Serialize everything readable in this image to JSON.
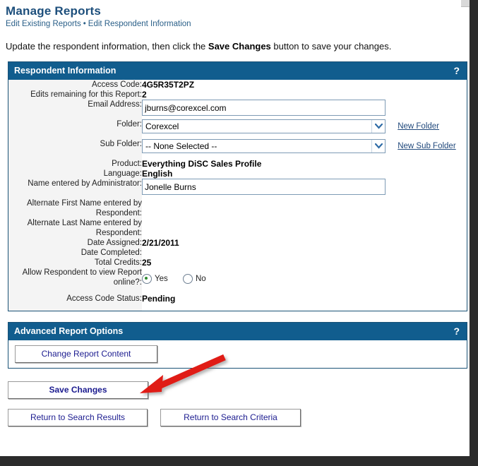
{
  "header": {
    "title": "Manage Reports",
    "breadcrumb": {
      "first": "Edit Existing Reports",
      "separator": "•",
      "second": "Edit Respondent Information"
    }
  },
  "intro": {
    "before": "Update the respondent information, then click the ",
    "emphasis": "Save Changes",
    "after": " button to save your changes."
  },
  "respondent_panel": {
    "title": "Respondent Information",
    "help": "?",
    "rows": {
      "access_code": {
        "label": "Access Code:",
        "value": "4G5R35T2PZ"
      },
      "edits_remaining": {
        "label": "Edits remaining for this Report:",
        "value": "2"
      },
      "email": {
        "label": "Email Address:",
        "value": "jburns@corexcel.com"
      },
      "folder": {
        "label": "Folder:",
        "value": "Corexcel",
        "link": "New Folder"
      },
      "sub_folder": {
        "label": "Sub Folder:",
        "value": "-- None Selected --",
        "link": "New Sub Folder"
      },
      "product": {
        "label": "Product:",
        "value": "Everything DiSC Sales Profile"
      },
      "language": {
        "label": "Language:",
        "value": "English"
      },
      "admin_name": {
        "label": "Name entered by Administrator:",
        "value": "Jonelle Burns"
      },
      "alt_first": {
        "label": "Alternate First Name entered by Respondent:",
        "value": ""
      },
      "alt_last": {
        "label": "Alternate Last Name entered by Respondent:",
        "value": ""
      },
      "date_assigned": {
        "label": "Date Assigned:",
        "value": "2/21/2011"
      },
      "date_completed": {
        "label": "Date Completed:",
        "value": ""
      },
      "total_credits": {
        "label": "Total Credits:",
        "value": "25"
      },
      "allow_view": {
        "label": "Allow Respondent to view Report online?:",
        "yes_label": "Yes",
        "no_label": "No",
        "selected": "Yes"
      },
      "access_status": {
        "label": "Access Code Status:",
        "value": "Pending"
      }
    }
  },
  "advanced_panel": {
    "title": "Advanced Report Options",
    "help": "?",
    "change_report_content_label": "Change Report Content"
  },
  "actions": {
    "save_label": "Save Changes",
    "return_results_label": "Return to Search Results",
    "return_criteria_label": "Return to Search Criteria"
  },
  "colors": {
    "panel_header_blue": "#115d8e",
    "title_blue": "#1d4f7c",
    "link_blue": "#21497c",
    "button_text_blue": "#1b1b8f",
    "annotation_red": "#e01b14",
    "radio_selected_green": "#2e8b2e",
    "label_column_grey": "#f4f4f4"
  }
}
